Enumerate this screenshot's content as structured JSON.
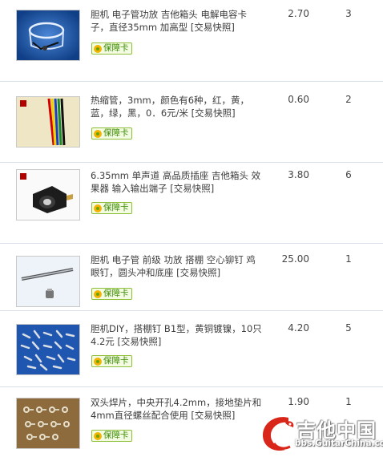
{
  "badge_label": "保障卡",
  "items": [
    {
      "title": "胆机 电子管功放 吉他箱头 电解电容卡子，直径35mm 加高型 [交易快照]",
      "price": "2.70",
      "qty": "3",
      "icon": "capacitor-clamp-image"
    },
    {
      "title": "热缩管，3mm，颜色有6种，红，黄，蓝，绿，黑，0．6元/米 [交易快照]",
      "price": "0.60",
      "qty": "2",
      "icon": "heat-shrink-tube-image"
    },
    {
      "title": "6.35mm 单声道 高品质插座 吉他箱头 效果器 输入输出端子 [交易快照]",
      "price": "3.80",
      "qty": "6",
      "icon": "audio-jack-image"
    },
    {
      "title": "胆机 电子管 前级 功放 搭棚 空心铆钉 鸡眼钉，圆头冲和底座 [交易快照]",
      "price": "25.00",
      "qty": "1",
      "icon": "rivet-tool-image"
    },
    {
      "title": "胆机DIY，搭棚钉 B1型，黄铜镀镍，10只4.2元 [交易快照]",
      "price": "4.20",
      "qty": "5",
      "icon": "turret-pins-image"
    },
    {
      "title": "双头焊片，中央开孔4.2mm，接地垫片和4mm直径螺丝配合使用 [交易快照]",
      "price": "1.90",
      "qty": "1",
      "icon": "solder-lugs-image"
    }
  ],
  "watermark": {
    "name": "吉他中国",
    "url": "bbs.GuitarChina.com"
  }
}
